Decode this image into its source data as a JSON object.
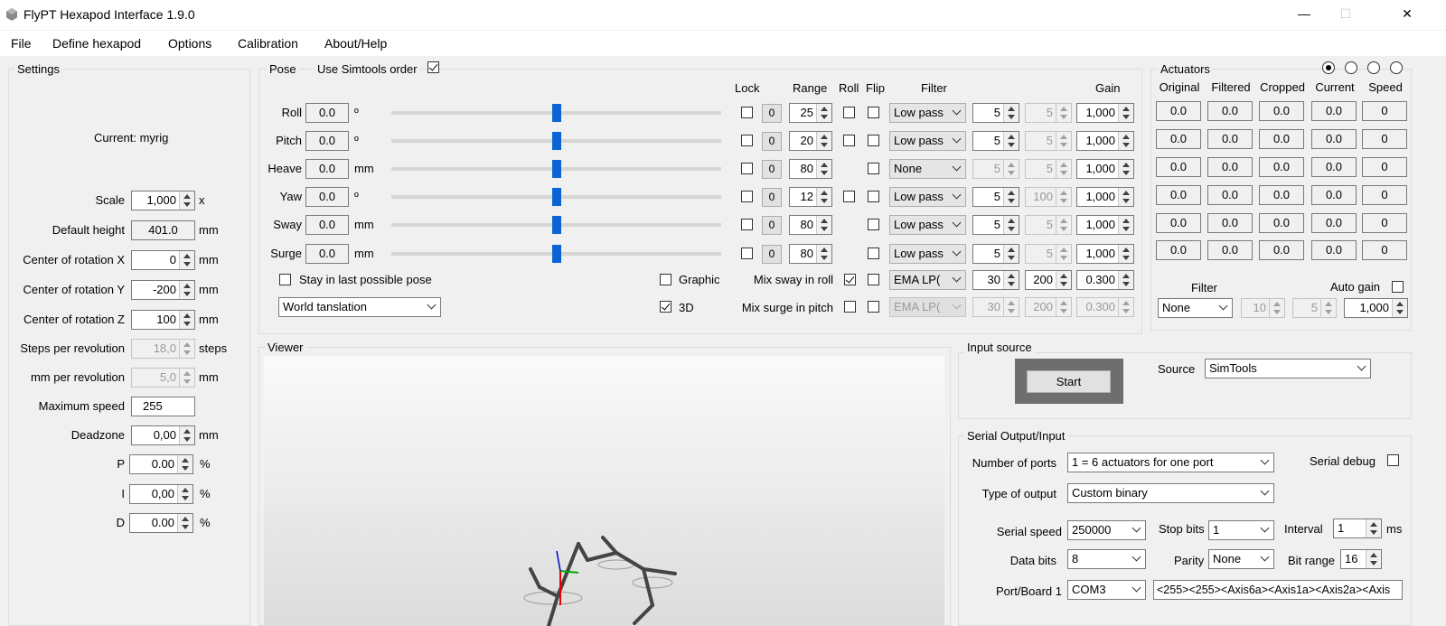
{
  "window": {
    "title": "FlyPT Hexapod Interface 1.9.0",
    "min": "—",
    "max": "☐",
    "close": "✕"
  },
  "menu": [
    "File",
    "Define hexapod",
    "Options",
    "Calibration",
    "About/Help"
  ],
  "settings": {
    "title": "Settings",
    "current": "Current: myrig",
    "rows": [
      {
        "label": "Scale",
        "value": "1,000",
        "unit": "x"
      },
      {
        "label": "Default height",
        "value": "401.0",
        "unit": "mm"
      },
      {
        "label": "Center of rotation X",
        "value": "0",
        "unit": "mm"
      },
      {
        "label": "Center of rotation Y",
        "value": "-200",
        "unit": "mm"
      },
      {
        "label": "Center of rotation Z",
        "value": "100",
        "unit": "mm"
      },
      {
        "label": "Steps per revolution",
        "value": "18,0",
        "unit": "steps"
      },
      {
        "label": "mm per revolution",
        "value": "5,0",
        "unit": "mm"
      },
      {
        "label": "Maximum speed",
        "value": "255",
        "unit": ""
      },
      {
        "label": "Deadzone",
        "value": "0,00",
        "unit": "mm"
      },
      {
        "label": "P",
        "value": "0.00",
        "unit": "%"
      },
      {
        "label": "I",
        "value": "0,00",
        "unit": "%"
      },
      {
        "label": "D",
        "value": "0.00",
        "unit": "%"
      }
    ]
  },
  "pose": {
    "title": "Pose",
    "simtools_order": "Use Simtools order",
    "headers": {
      "lock": "Lock",
      "range": "Range",
      "roll": "Roll",
      "flip": "Flip",
      "filter": "Filter",
      "gain": "Gain"
    },
    "rows": [
      {
        "name": "Roll",
        "value": "0.0",
        "unit": "º",
        "slider": 0.5,
        "lock": "0",
        "range": "25",
        "roll_chk": true,
        "filter": "Low pass",
        "f1": "5",
        "f2": "5",
        "gain": "1,000"
      },
      {
        "name": "Pitch",
        "value": "0.0",
        "unit": "º",
        "slider": 0.5,
        "lock": "0",
        "range": "20",
        "roll_chk": true,
        "filter": "Low pass",
        "f1": "5",
        "f2": "5",
        "gain": "1,000"
      },
      {
        "name": "Heave",
        "value": "0.0",
        "unit": "mm",
        "slider": 0.5,
        "lock": "0",
        "range": "80",
        "roll_chk": false,
        "filter": "None",
        "f1": "5",
        "f2": "5",
        "gain": "1,000"
      },
      {
        "name": "Yaw",
        "value": "0.0",
        "unit": "º",
        "slider": 0.5,
        "lock": "0",
        "range": "12",
        "roll_chk": true,
        "filter": "Low pass",
        "f1": "5",
        "f2": "100",
        "gain": "1,000"
      },
      {
        "name": "Sway",
        "value": "0.0",
        "unit": "mm",
        "slider": 0.5,
        "lock": "0",
        "range": "80",
        "roll_chk": false,
        "filter": "Low pass",
        "f1": "5",
        "f2": "5",
        "gain": "1,000"
      },
      {
        "name": "Surge",
        "value": "0.0",
        "unit": "mm",
        "slider": 0.5,
        "lock": "0",
        "range": "80",
        "roll_chk": false,
        "filter": "Low pass",
        "f1": "5",
        "f2": "5",
        "gain": "1,000"
      }
    ],
    "stay_last": "Stay in last possible pose",
    "translation": "World tanslation",
    "graphic": "Graphic",
    "three_d": "3D",
    "mix_sway": "Mix sway in roll",
    "mix_surge": "Mix surge in pitch",
    "mix_rows": [
      {
        "filter": "EMA LP(",
        "f1": "30",
        "f2": "200",
        "gain": "0.300"
      },
      {
        "filter": "EMA LP(",
        "f1": "30",
        "f2": "200",
        "gain": "0.300"
      }
    ]
  },
  "actuators": {
    "title": "Actuators",
    "headers": [
      "Original",
      "Filtered",
      "Cropped",
      "Current",
      "Speed"
    ],
    "rows": [
      [
        "0.0",
        "0.0",
        "0.0",
        "0.0",
        "0"
      ],
      [
        "0.0",
        "0.0",
        "0.0",
        "0.0",
        "0"
      ],
      [
        "0.0",
        "0.0",
        "0.0",
        "0.0",
        "0"
      ],
      [
        "0.0",
        "0.0",
        "0.0",
        "0.0",
        "0"
      ],
      [
        "0.0",
        "0.0",
        "0.0",
        "0.0",
        "0"
      ],
      [
        "0.0",
        "0.0",
        "0.0",
        "0.0",
        "0"
      ]
    ],
    "filter_label": "Filter",
    "filter_value": "None",
    "f1": "10",
    "f2": "5",
    "auto_gain": "Auto gain",
    "gain": "1,000"
  },
  "viewer": {
    "title": "Viewer"
  },
  "input_source": {
    "title": "Input source",
    "start": "Start",
    "source_label": "Source",
    "source_value": "SimTools"
  },
  "serial": {
    "title": "Serial Output/Input",
    "ports_label": "Number of ports",
    "ports_value": "1 = 6 actuators for one port",
    "debug_label": "Serial debug",
    "type_label": "Type of output",
    "type_value": "Custom binary",
    "speed_label": "Serial speed",
    "speed_value": "250000",
    "stop_label": "Stop bits",
    "stop_value": "1",
    "interval_label": "Interval",
    "interval_value": "1",
    "interval_unit": "ms",
    "data_label": "Data bits",
    "data_value": "8",
    "parity_label": "Parity",
    "parity_value": "None",
    "bitrange_label": "Bit range",
    "bitrange_value": "16",
    "port_label": "Port/Board 1",
    "port_value": "COM3",
    "output_string": "<255><255><Axis6a><Axis1a><Axis2a><Axis"
  }
}
